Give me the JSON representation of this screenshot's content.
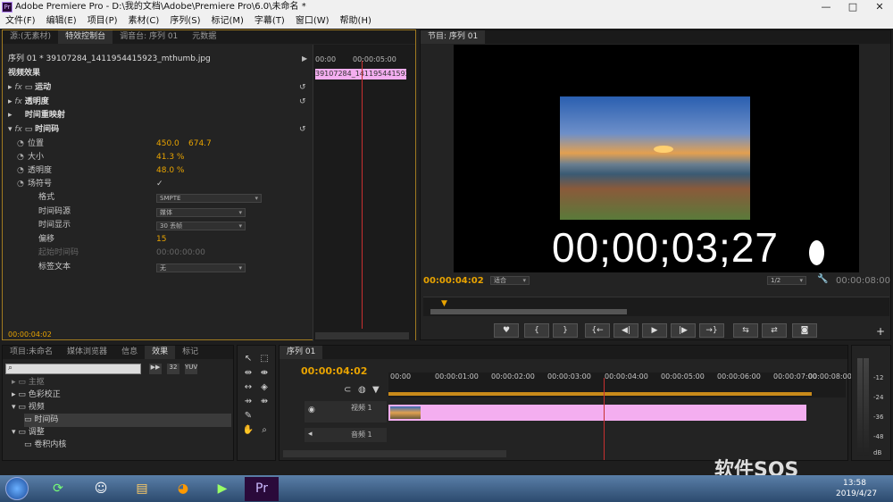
{
  "window": {
    "title": "Adobe Premiere Pro - D:\\我的文档\\Adobe\\Premiere Pro\\6.0\\未命名 *",
    "app_icon": "Pr",
    "controls": [
      "—",
      "□",
      "✕"
    ]
  },
  "menu": [
    "文件(F)",
    "编辑(E)",
    "项目(P)",
    "素材(C)",
    "序列(S)",
    "标记(M)",
    "字幕(T)",
    "窗口(W)",
    "帮助(H)"
  ],
  "effect_controls": {
    "tabs": [
      "源:(无素材)",
      "特效控制台",
      "调音台: 序列 01",
      "元数据"
    ],
    "clip_label": "序列 01 * 39107284_1411954415923_mthumb.jpg",
    "section": "视频效果",
    "effects": [
      "运动",
      "透明度",
      "时间重映射",
      "时间码"
    ],
    "props": {
      "position_label": "位置",
      "position_x": "450.0",
      "position_y": "674.7",
      "scale_label": "大小",
      "scale_value": "41.3 %",
      "opacity_label": "透明度",
      "opacity_value": "48.0 %",
      "field_label": "场符号",
      "field_check": "✓",
      "format_label": "格式",
      "format_value": "SMPTE",
      "source_label": "时间码源",
      "source_value": "媒体",
      "display_label": "时间显示",
      "display_value": "30 丢帧",
      "offset_label": "偏移",
      "offset_value": "15",
      "start_label": "起始时间码",
      "start_value": "00:00:00:00",
      "label_label": "标签文本",
      "label_value": "无"
    },
    "mini_timeline": {
      "ruler_start": "00:00",
      "ruler_mid": "00:00:05:00",
      "clip_name": "39107284_1411954415923_"
    },
    "bottom_time": "00:00:04:02"
  },
  "program": {
    "tab": "节目: 序列 01",
    "overlay_timecode": "00;00;03;27",
    "current_time": "00:00:04:02",
    "fit": "适合",
    "res": "1/2",
    "duration": "00:00:08:00",
    "controls": [
      "♥",
      "{",
      "}",
      "{←",
      "◀|",
      "▶",
      "|▶",
      "→}",
      "⇆",
      "⇄",
      "◙"
    ]
  },
  "project": {
    "tabs": [
      "项目:未命名",
      "媒体浏览器",
      "信息",
      "效果",
      "标记"
    ],
    "items": [
      "主抠",
      "色彩校正",
      "视频",
      "时间码",
      "调整",
      "卷积内核"
    ]
  },
  "timeline": {
    "tab": "序列 01",
    "current_time": "00:00:04:02",
    "ruler": [
      "00:00",
      "00:00:01:00",
      "00:00:02:00",
      "00:00:03:00",
      "00:00:04:00",
      "00:00:05:00",
      "00:00:06:00",
      "00:00:07:00",
      "00:00:08:00"
    ],
    "video_track": "视频 1",
    "audio_track": "音频 1"
  },
  "meter": {
    "ticks": [
      "-12",
      "-24",
      "-36",
      "-48",
      "dB"
    ]
  },
  "taskbar": {
    "time": "13:58",
    "date": "2019/4/27"
  },
  "watermark": "软件SOS",
  "colors": {
    "accent": "#e8a300",
    "clip": "#f4aef0",
    "playhead": "#c83030",
    "selection_blue": "#7fa7e8"
  }
}
